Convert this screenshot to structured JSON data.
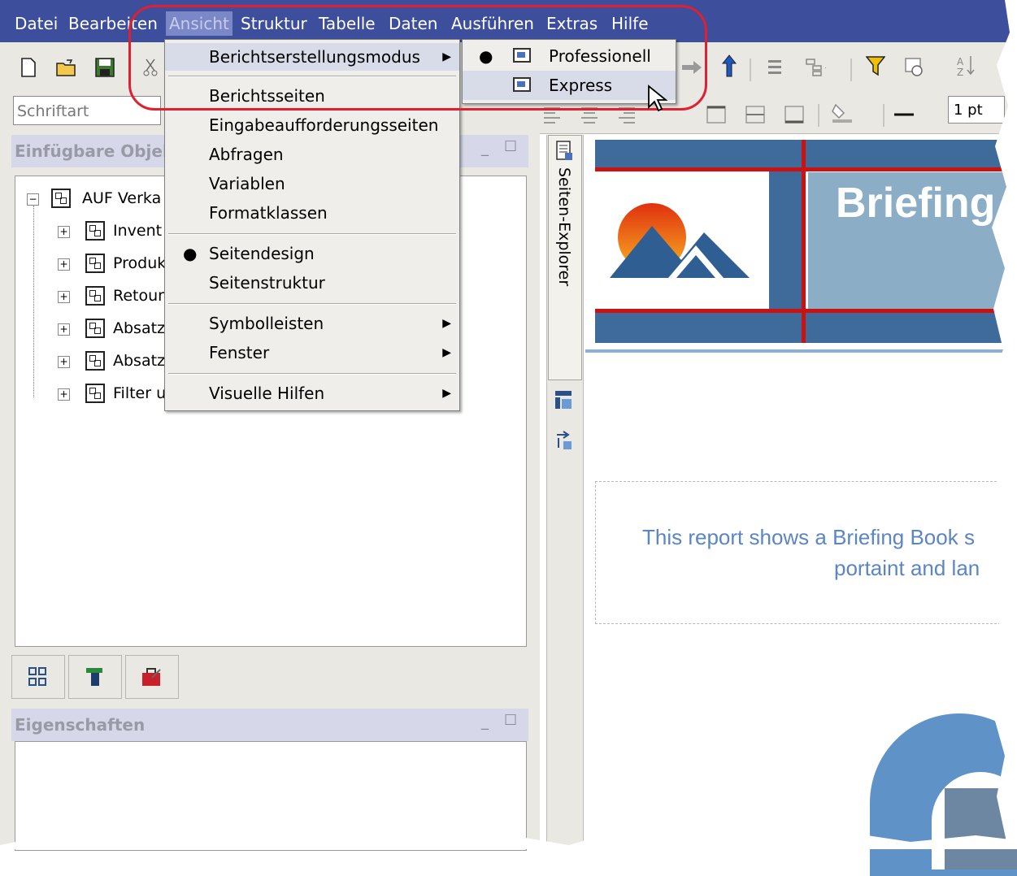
{
  "menubar": {
    "items": [
      "Datei",
      "Bearbeiten",
      "Ansicht",
      "Struktur",
      "Tabelle",
      "Daten",
      "Ausführen",
      "Extras",
      "Hilfe"
    ],
    "active": "Ansicht"
  },
  "toolbar": {
    "font_placeholder": "Schriftart",
    "line_width": "1 pt"
  },
  "menu": {
    "items": [
      {
        "label": "Berichtserstellungsmodus"
      },
      {
        "label": "Berichtsseiten"
      },
      {
        "label": "Eingabeaufforderungsseiten"
      },
      {
        "label": "Abfragen"
      },
      {
        "label": "Variablen"
      },
      {
        "label": "Formatklassen"
      },
      {
        "label": "Seitendesign"
      },
      {
        "label": "Seitenstruktur"
      },
      {
        "label": "Symbolleisten"
      },
      {
        "label": "Fenster"
      },
      {
        "label": "Visuelle Hilfen"
      }
    ],
    "checked": "Seitendesign"
  },
  "submenu": {
    "items": [
      {
        "label": "Professionell"
      },
      {
        "label": "Express"
      }
    ],
    "checked": "Professionell",
    "hovered": "Express"
  },
  "insertable_panel": {
    "title": "Einfügbare Objel",
    "root": "AUF Verka",
    "children": [
      "Invent",
      "Produk",
      "Retour",
      "Absatz",
      "Absatz",
      "Filter u"
    ]
  },
  "properties_panel": {
    "title": "Eigenschaften"
  },
  "explorer_tab": {
    "label": "Seiten-Explorer"
  },
  "report": {
    "title": "Briefing",
    "description_line1": "This report shows a Briefing Book s",
    "description_line2": "portaint and lan"
  },
  "colors": {
    "menubar": "#3c4e9c",
    "highlight": "#e02030",
    "report_band": "#3f6b9a",
    "report_header": "#8badc6",
    "report_text": "#5b86c2"
  },
  "icons": [
    "new-document-icon",
    "open-folder-icon",
    "save-icon",
    "cut-icon",
    "arrow-right-icon",
    "arrow-up-icon",
    "filter-icon",
    "sort-icon",
    "cursor-icon"
  ]
}
